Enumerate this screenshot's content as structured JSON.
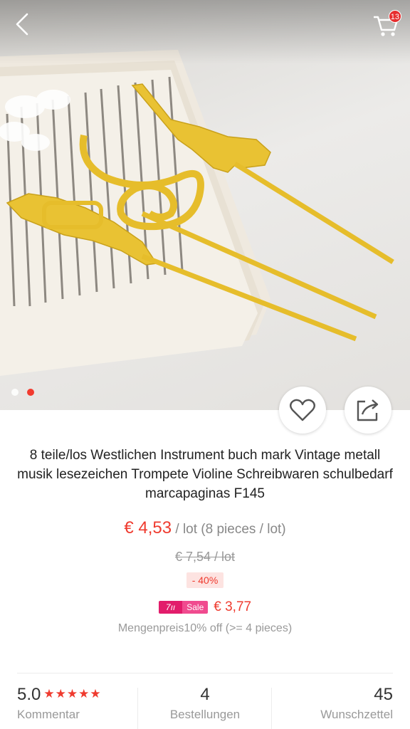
{
  "header": {
    "back_icon": "chevron-left-icon",
    "cart_icon": "cart-icon",
    "cart_count": "13"
  },
  "gallery": {
    "slides": 2,
    "active_index": 1
  },
  "actions": {
    "wishlist_icon": "heart-outline-icon",
    "share_icon": "share-icon"
  },
  "product": {
    "title": "8 teile/los Westlichen Instrument buch mark Vintage metall musik lesezeichen Trompete Violine Schreibwaren schulbedarf marcapaginas F145",
    "price": "€ 4,53",
    "unit": " / lot (8 pieces / lot)",
    "original_price": "€ 7,54  / lot",
    "discount": "- 40%",
    "sale_tag_left": "7ıı",
    "sale_tag_right": "Sale",
    "sale_price": "€ 3,77",
    "bulk_price": "Mengenpreis10% off (>= 4 pieces)"
  },
  "stats": {
    "rating_value": "5.0",
    "rating_stars": "★★★★★",
    "rating_label": "Kommentar",
    "orders_value": "4",
    "orders_label": "Bestellungen",
    "wishlist_value": "45",
    "wishlist_label": "Wunschzettel"
  },
  "colors": {
    "accent": "#ef3b2f",
    "sale_pink": "#e21c6b",
    "muted": "#999999"
  }
}
